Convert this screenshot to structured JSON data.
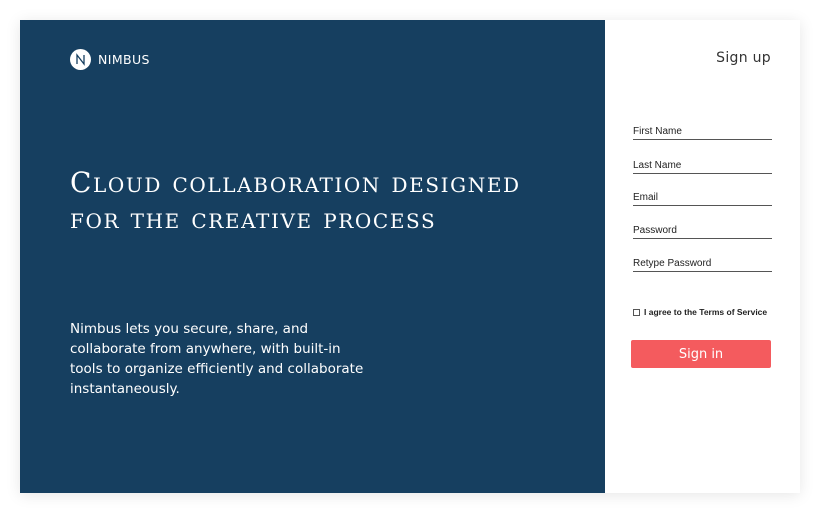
{
  "brand": {
    "name": "NIMBUS",
    "logo_icon": "nimbus-logo-icon"
  },
  "hero": {
    "headline": "Cloud collaboration designed for the creative process",
    "description": "Nimbus lets you secure, share, and collaborate from anywhere, with built-in tools to organize efficiently and collaborate instantaneously."
  },
  "signup": {
    "title": "Sign up",
    "fields": [
      {
        "placeholder": "First Name",
        "value": ""
      },
      {
        "placeholder": "Last Name",
        "value": ""
      },
      {
        "placeholder": "Email",
        "value": ""
      },
      {
        "placeholder": "Password",
        "value": ""
      },
      {
        "placeholder": "Retype Password",
        "value": ""
      }
    ],
    "terms_label": "I agree to the Terms of Service",
    "terms_checked": false,
    "submit_label": "Sign in"
  },
  "colors": {
    "hero_background": "#163f60",
    "accent": "#f45b5e",
    "panel_background": "#ffffff"
  }
}
